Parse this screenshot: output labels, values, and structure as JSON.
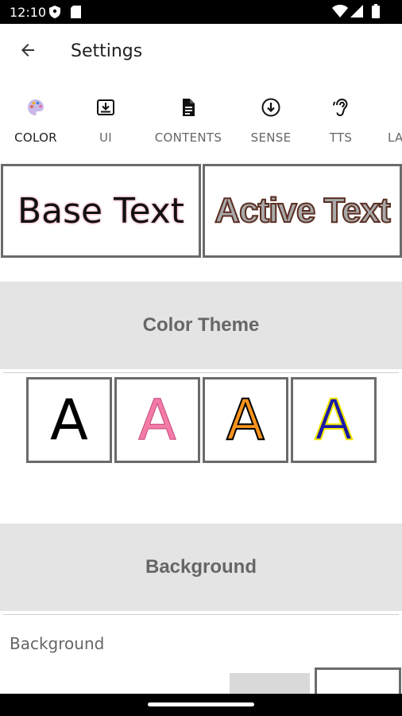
{
  "status_bar": {
    "time": "12:10",
    "icons": [
      "shield-icon",
      "sim-card-icon",
      "wifi-icon",
      "signal-icon",
      "battery-icon"
    ]
  },
  "app_bar": {
    "back_icon": "arrow-left-icon",
    "title": "Settings"
  },
  "tabs": [
    {
      "label": "COLOR",
      "icon": "palette-icon",
      "active": true
    },
    {
      "label": "UI",
      "icon": "download-box-icon",
      "active": false
    },
    {
      "label": "CONTENTS",
      "icon": "document-icon",
      "active": false
    },
    {
      "label": "SENSE",
      "icon": "arrow-down-circle-icon",
      "active": false
    },
    {
      "label": "TTS",
      "icon": "ear-icon",
      "active": false
    },
    {
      "label": "LA",
      "icon": "",
      "active": false
    }
  ],
  "preview": {
    "base_text": "Base Text",
    "active_text": "Active Text"
  },
  "color_theme": {
    "header": "Color Theme",
    "swatches": [
      {
        "letter": "A",
        "fill": "#000000",
        "outline": "#000000"
      },
      {
        "letter": "A",
        "fill": "#f47aa8",
        "outline": "#c24a7a"
      },
      {
        "letter": "A",
        "fill": "#f7931e",
        "outline": "#000000"
      },
      {
        "letter": "A",
        "fill": "#1a1aa6",
        "outline": "#f2e600"
      }
    ]
  },
  "background": {
    "header": "Background",
    "label": "Background",
    "options": [
      {
        "color": "#d9d9d9"
      },
      {
        "color": "#ffffff"
      }
    ]
  },
  "colors": {
    "accent": "#5aa1d6",
    "header_bg": "#e4e4e4",
    "border": "#6b6b6b"
  }
}
